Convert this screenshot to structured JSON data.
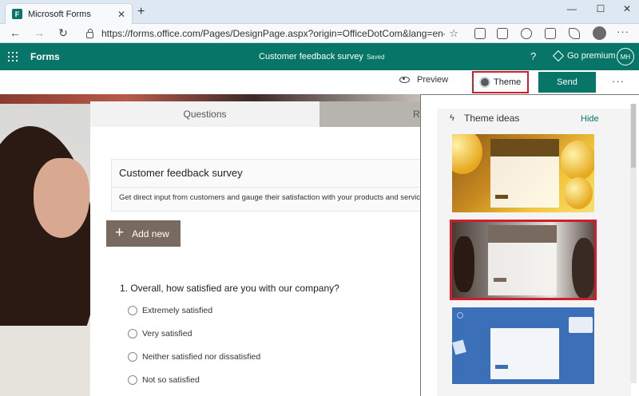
{
  "browser": {
    "tab_title": "Microsoft Forms",
    "tab_close": "✕",
    "new_tab": "+",
    "url": "https://forms.office.com/Pages/DesignPage.aspx?origin=OfficeDotCom&lang=en-US&...",
    "win_min": "—",
    "win_max": "☐",
    "win_close": "✕",
    "back": "←",
    "forward": "→",
    "reload": "↻",
    "star": "☆",
    "more": "···"
  },
  "appbar": {
    "app_name": "Forms",
    "doc_title": "Customer feedback survey",
    "saved": "Saved",
    "help": "?",
    "premium": "Go premium",
    "avatar_initials": "MH"
  },
  "commands": {
    "preview": "Preview",
    "theme": "Theme",
    "send": "Send",
    "more": "···"
  },
  "form": {
    "tabs": [
      "Questions",
      "Responses"
    ],
    "title": "Customer feedback survey",
    "description": "Get direct input from customers and gauge their satisfaction with your products and services.",
    "add_new": "Add new",
    "question": {
      "text": "1. Overall, how satisfied are you with our company?",
      "options": [
        "Extremely satisfied",
        "Very satisfied",
        "Neither satisfied nor dissatisfied",
        "Not so satisfied"
      ]
    }
  },
  "theme_panel": {
    "heading": "Theme ideas",
    "hide": "Hide",
    "themes": [
      {
        "name": "yellow-balloons",
        "accent": "#6b4d1c"
      },
      {
        "name": "office-people",
        "accent": "#786a5f",
        "selected": true
      },
      {
        "name": "blue-illustration",
        "accent": "#3b6fb8"
      }
    ]
  },
  "colors": {
    "brand": "#077568",
    "highlight": "#d01f2c",
    "add_button": "#786a5f"
  }
}
